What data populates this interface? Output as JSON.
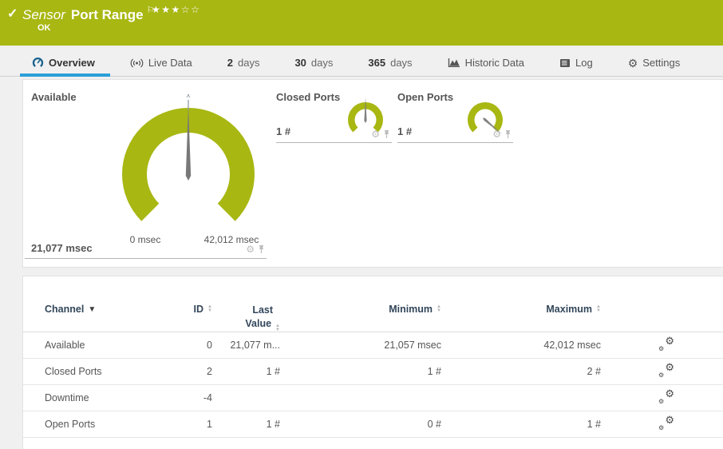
{
  "icons": {
    "check": "✓",
    "flag": "⚐",
    "star_filled": "★",
    "star_empty": "☆",
    "gear": "⚙",
    "sort_up": "▲",
    "sort_down": "▼",
    "sort_desc": "▼"
  },
  "header": {
    "type_label": "Sensor",
    "title": "Port Range",
    "status": "OK",
    "rating_filled": 3,
    "rating_empty": 2
  },
  "tabs": [
    {
      "label": "Overview",
      "active": true
    },
    {
      "label": "Live Data"
    },
    {
      "prefix": "2",
      "label": "days"
    },
    {
      "prefix": "30",
      "label": "days"
    },
    {
      "prefix": "365",
      "label": "days"
    },
    {
      "label": "Historic Data"
    },
    {
      "label": "Log"
    },
    {
      "label": "Settings"
    }
  ],
  "gauges": {
    "available": {
      "label": "Available",
      "value": "21,077 msec",
      "scale_min": "0 msec",
      "scale_max": "42,012 msec",
      "mean_marker": "x̄",
      "needle_angle": 0
    },
    "closed_ports": {
      "label": "Closed Ports",
      "value": "1 #",
      "needle_angle": 0
    },
    "open_ports": {
      "label": "Open Ports",
      "value": "1 #",
      "needle_angle": 131
    }
  },
  "table": {
    "headers": {
      "channel": "Channel",
      "id": "ID",
      "last_line1": "Last",
      "last_line2": "Value",
      "minimum": "Minimum",
      "maximum": "Maximum"
    },
    "rows": [
      {
        "channel": "Available",
        "id": "0",
        "last_value": "21,077 m...",
        "minimum": "21,057 msec",
        "maximum": "42,012 msec"
      },
      {
        "channel": "Closed Ports",
        "id": "2",
        "last_value": "1 #",
        "minimum": "1 #",
        "maximum": "2 #"
      },
      {
        "channel": "Downtime",
        "id": "-4",
        "last_value": "",
        "minimum": "",
        "maximum": ""
      },
      {
        "channel": "Open Ports",
        "id": "1",
        "last_value": "1 #",
        "minimum": "0 #",
        "maximum": "1 #"
      }
    ]
  },
  "colors": {
    "header_green": "#a8b712",
    "gauge_green": "#a8b712",
    "accent_blue": "#2b9fd9",
    "table_header_text": "#32465a"
  }
}
